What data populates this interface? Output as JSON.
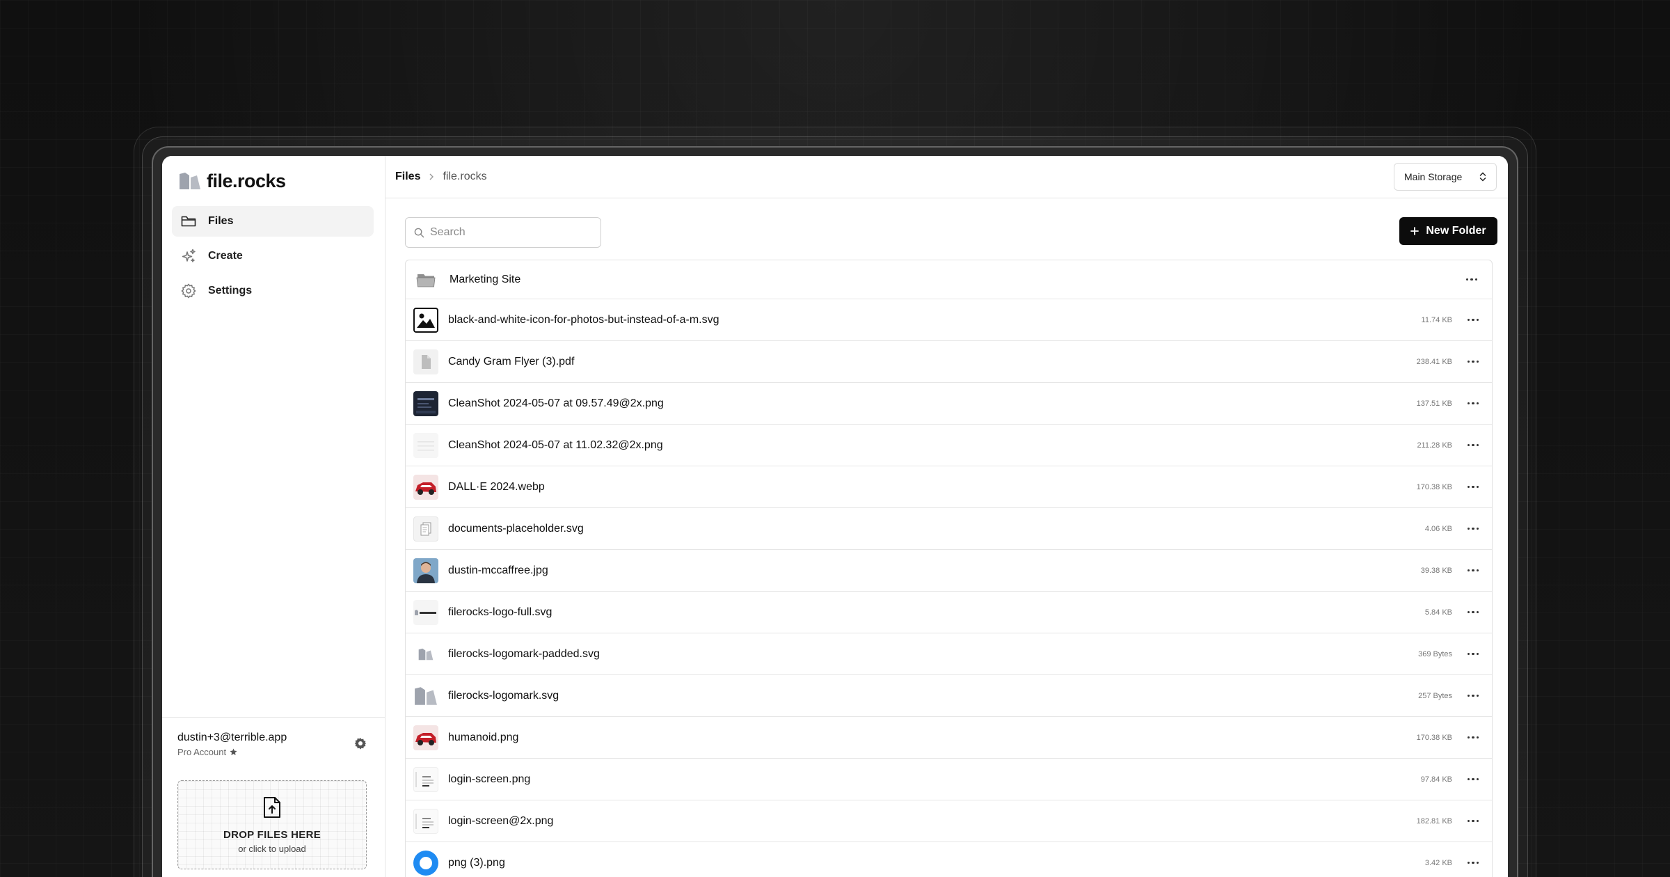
{
  "brand": {
    "name": "file.rocks"
  },
  "sidebar": {
    "items": [
      {
        "label": "Files",
        "icon": "folder-icon",
        "active": true
      },
      {
        "label": "Create",
        "icon": "sparkles-icon",
        "active": false
      },
      {
        "label": "Settings",
        "icon": "gear-icon",
        "active": false
      }
    ]
  },
  "account": {
    "email": "dustin+3@terrible.app",
    "plan": "Pro Account"
  },
  "dropzone": {
    "title": "DROP FILES HERE",
    "subtitle": "or click to upload"
  },
  "breadcrumb": {
    "root": "Files",
    "current": "file.rocks"
  },
  "storage": {
    "selected": "Main Storage"
  },
  "search": {
    "placeholder": "Search"
  },
  "toolbar": {
    "new_folder_label": "New Folder"
  },
  "folders": [
    {
      "name": "Marketing Site"
    }
  ],
  "files": [
    {
      "name": "black-and-white-icon-for-photos-but-instead-of-a-m.svg",
      "size": "11.74 KB",
      "thumb": "bw-photo"
    },
    {
      "name": "Candy Gram Flyer (3).pdf",
      "size": "238.41 KB",
      "thumb": "pdf"
    },
    {
      "name": "CleanShot 2024-05-07 at 09.57.49@2x.png",
      "size": "137.51 KB",
      "thumb": "dark-screenshot"
    },
    {
      "name": "CleanShot 2024-05-07 at 11.02.32@2x.png",
      "size": "211.28 KB",
      "thumb": "light-screenshot"
    },
    {
      "name": "DALL·E 2024.webp",
      "size": "170.38 KB",
      "thumb": "red-car"
    },
    {
      "name": "documents-placeholder.svg",
      "size": "4.06 KB",
      "thumb": "documents"
    },
    {
      "name": "dustin-mccaffree.jpg",
      "size": "39.38 KB",
      "thumb": "portrait"
    },
    {
      "name": "filerocks-logo-full.svg",
      "size": "5.84 KB",
      "thumb": "logo-full"
    },
    {
      "name": "filerocks-logomark-padded.svg",
      "size": "369 Bytes",
      "thumb": "logomark-small"
    },
    {
      "name": "filerocks-logomark.svg",
      "size": "257 Bytes",
      "thumb": "logomark"
    },
    {
      "name": "humanoid.png",
      "size": "170.38 KB",
      "thumb": "red-car"
    },
    {
      "name": "login-screen.png",
      "size": "97.84 KB",
      "thumb": "login"
    },
    {
      "name": "login-screen@2x.png",
      "size": "182.81 KB",
      "thumb": "login"
    },
    {
      "name": "png (3).png",
      "size": "3.42 KB",
      "thumb": "blue-circle"
    }
  ],
  "colors": {
    "accent": "#0c0c0c",
    "background": "#0e0e0e",
    "logo": "#9ea3ad"
  }
}
